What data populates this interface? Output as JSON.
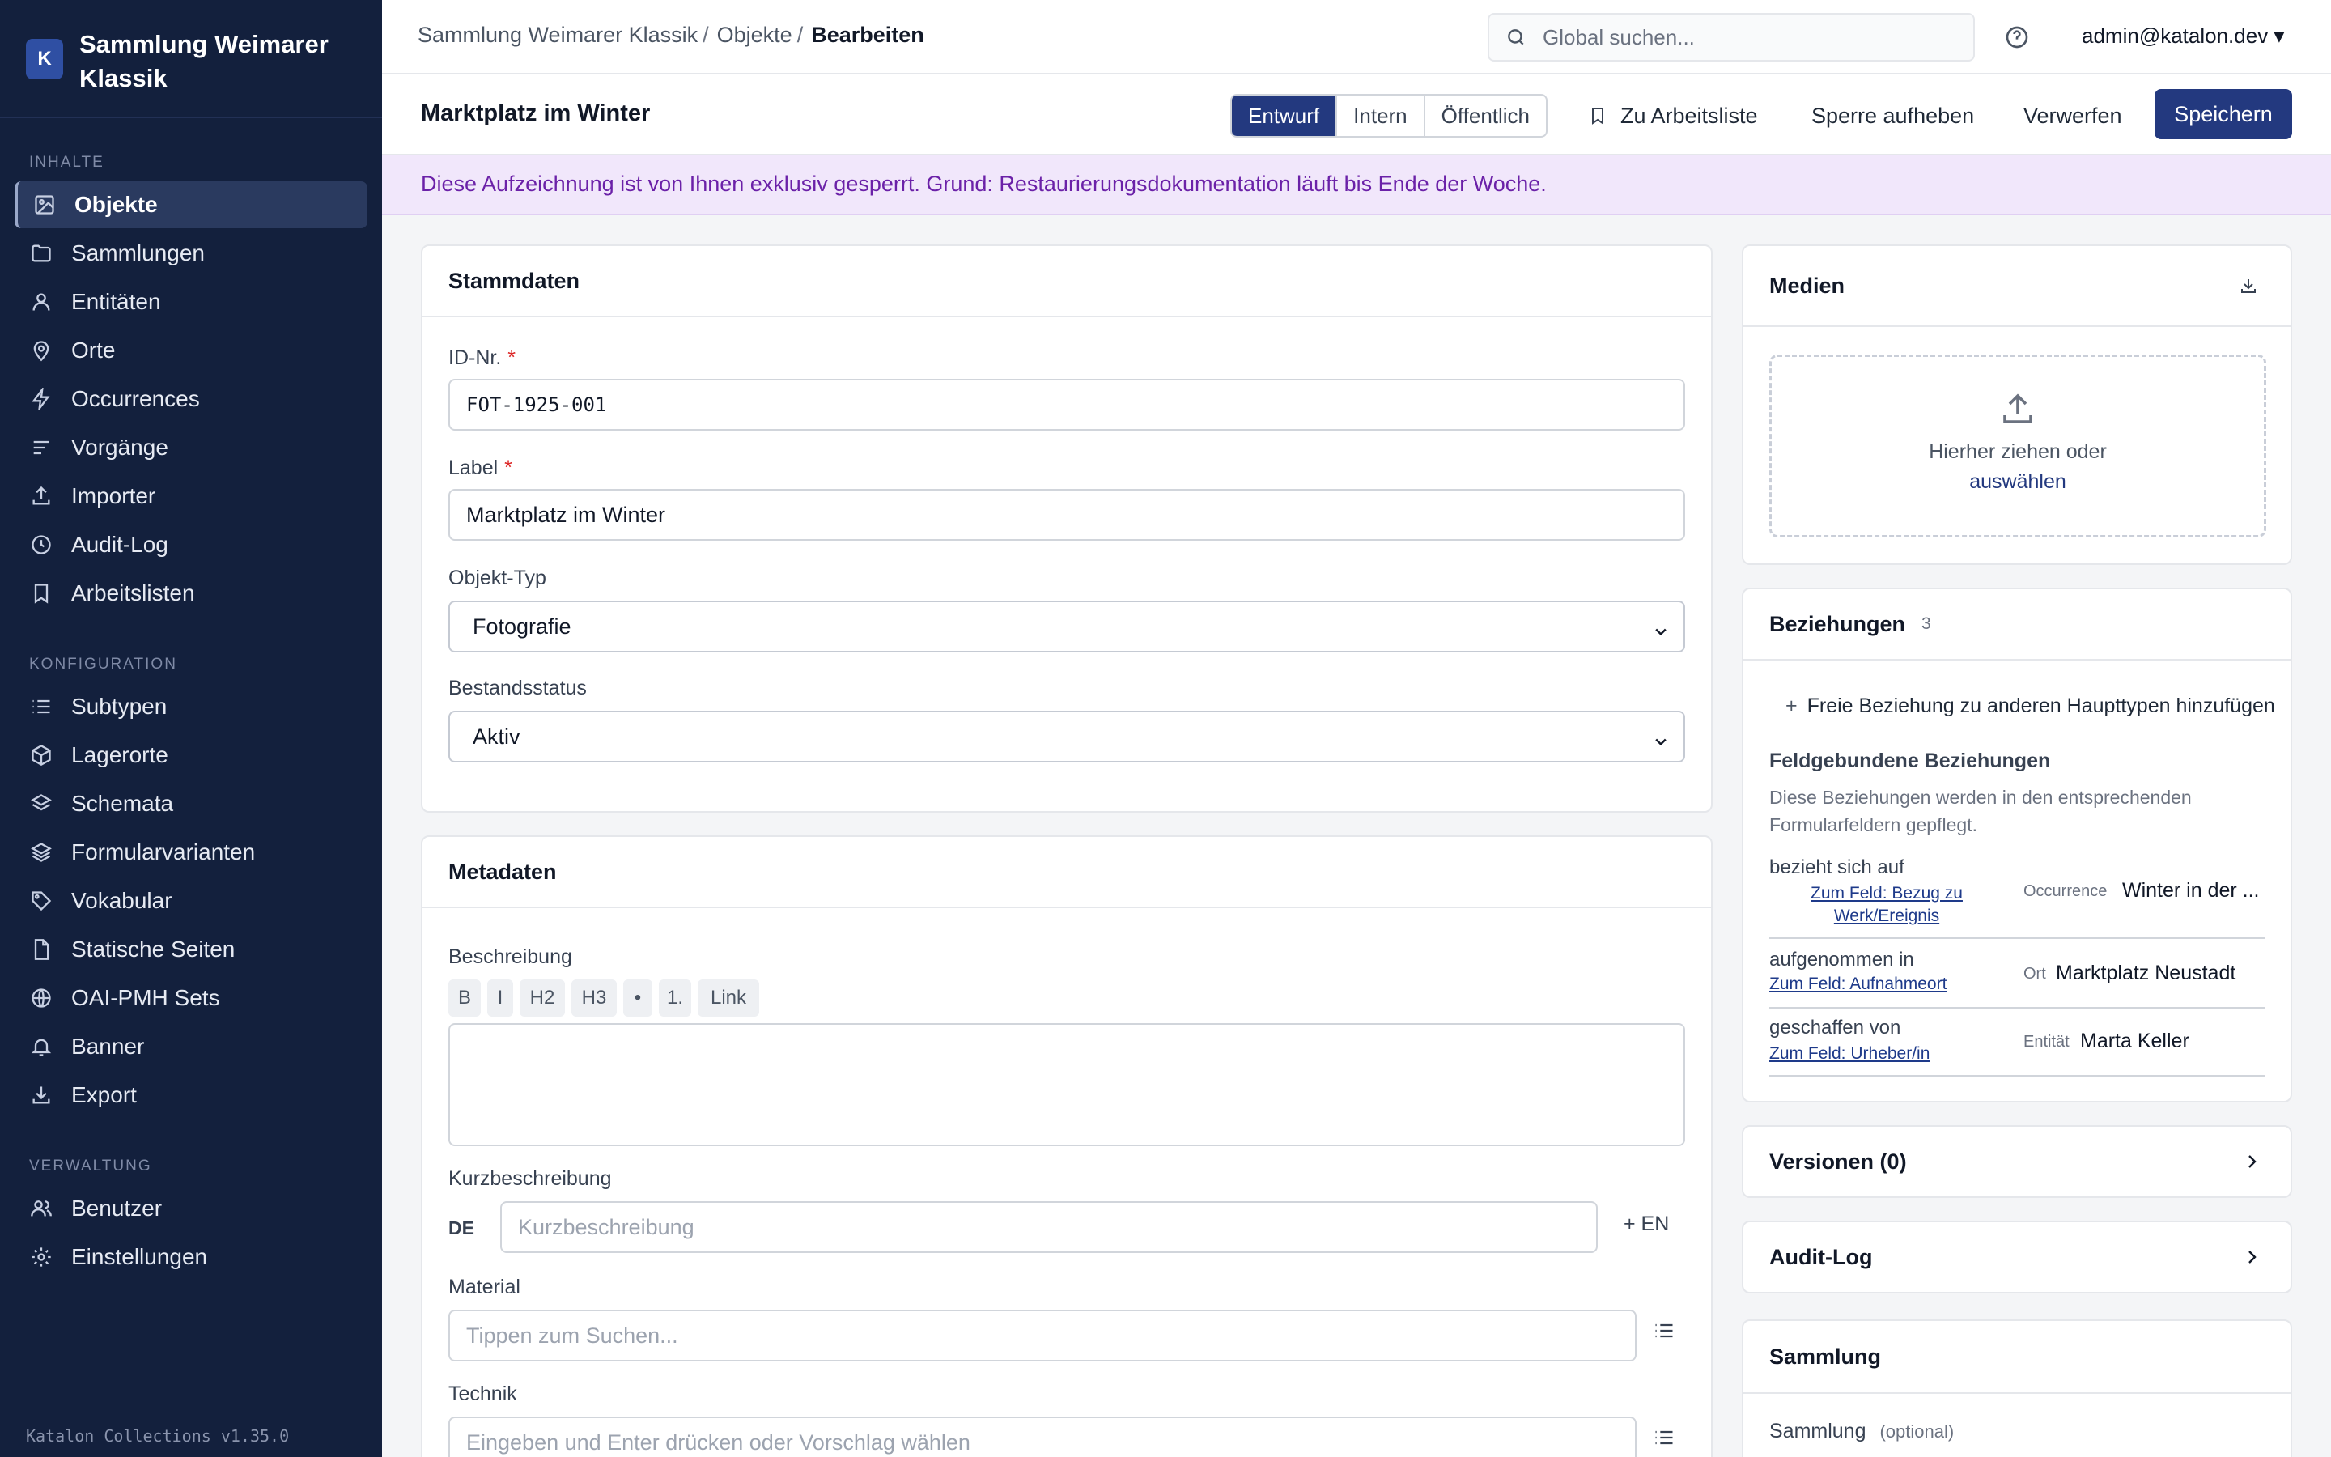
{
  "sidebar": {
    "logo_letter": "K",
    "title": "Sammlung Weimarer Klassik",
    "sections": {
      "inhalte": "INHALTE",
      "konfiguration": "KONFIGURATION",
      "verwaltung": "VERWALTUNG"
    },
    "items": {
      "objekte": "Objekte",
      "sammlungen": "Sammlungen",
      "entitaeten": "Entitäten",
      "orte": "Orte",
      "occurrences": "Occurrences",
      "vorgaenge": "Vorgänge",
      "importer": "Importer",
      "auditlog": "Audit-Log",
      "arbeitslisten": "Arbeitslisten",
      "subtypen": "Subtypen",
      "lagerorte": "Lagerorte",
      "schemata": "Schemata",
      "formularvarianten": "Formularvarianten",
      "vokabular": "Vokabular",
      "statische_seiten": "Statische Seiten",
      "oai_pmh": "OAI-PMH Sets",
      "banner": "Banner",
      "export": "Export",
      "benutzer": "Benutzer",
      "einstellungen": "Einstellungen"
    },
    "version": "Katalon Collections v1.35.0"
  },
  "topbar": {
    "breadcrumb": [
      "Sammlung Weimarer Klassik",
      "Objekte",
      "Bearbeiten"
    ],
    "separator": "/",
    "search_placeholder": "Global suchen...",
    "user": "admin@katalon.dev ▾"
  },
  "header": {
    "title": "Marktplatz im Winter",
    "status": [
      "Entwurf",
      "Intern",
      "Öffentlich"
    ],
    "status_selected": "Entwurf",
    "worklist": "Zu Arbeitsliste",
    "unlock": "Sperre aufheben",
    "discard": "Verwerfen",
    "save": "Speichern"
  },
  "lock_notice": "Diese Aufzeichnung ist von Ihnen exklusiv gesperrt. Grund: Restaurierungsdokumentation läuft bis Ende der Woche.",
  "stammdaten": {
    "title": "Stammdaten",
    "id_label": "ID-Nr.",
    "id_value": "FOT-1925-001",
    "label_label": "Label",
    "label_value": "Marktplatz im Winter",
    "type_label": "Objekt-Typ",
    "type_value": "Fotografie",
    "status_label": "Bestandsstatus",
    "status_value": "Aktiv",
    "required_mark": "*"
  },
  "metadaten": {
    "title": "Metadaten",
    "beschreibung_label": "Beschreibung",
    "toolbar": [
      "B",
      "I",
      "H2",
      "H3",
      "•",
      "1.",
      "Link"
    ],
    "kurz_label": "Kurzbeschreibung",
    "kurz_lang": "DE",
    "kurz_placeholder": "Kurzbeschreibung",
    "add_lang": "+ EN",
    "material_label": "Material",
    "material_placeholder": "Tippen zum Suchen...",
    "technik_label": "Technik",
    "technik_placeholder": "Eingeben und Enter drücken oder Vorschlag wählen"
  },
  "medien": {
    "title": "Medien",
    "drop_text": "Hierher ziehen oder",
    "drop_link": "auswählen"
  },
  "beziehungen": {
    "title": "Beziehungen",
    "count": "3",
    "add_free": "Freie Beziehung zu anderen Haupttypen hinzufügen",
    "bound_title": "Feldgebundene Beziehungen",
    "bound_desc": "Diese Beziehungen werden in den entsprechenden Formularfeldern gepflegt.",
    "rows": [
      {
        "label": "bezieht sich auf",
        "link": "Zum Feld: Bezug zu Werk/Ereignis",
        "type": "Occurrence",
        "value": "Winter in der ..."
      },
      {
        "label": "aufgenommen in",
        "link": "Zum Feld: Aufnahmeort",
        "type": "Ort",
        "value": "Marktplatz Neustadt"
      },
      {
        "label": "geschaffen von",
        "link": "Zum Feld: Urheber/in",
        "type": "Entität",
        "value": "Marta Keller"
      }
    ]
  },
  "versionen": "Versionen (0)",
  "audit": "Audit-Log",
  "sammlung": {
    "title": "Sammlung",
    "field_label": "Sammlung",
    "optional": "(optional)"
  }
}
